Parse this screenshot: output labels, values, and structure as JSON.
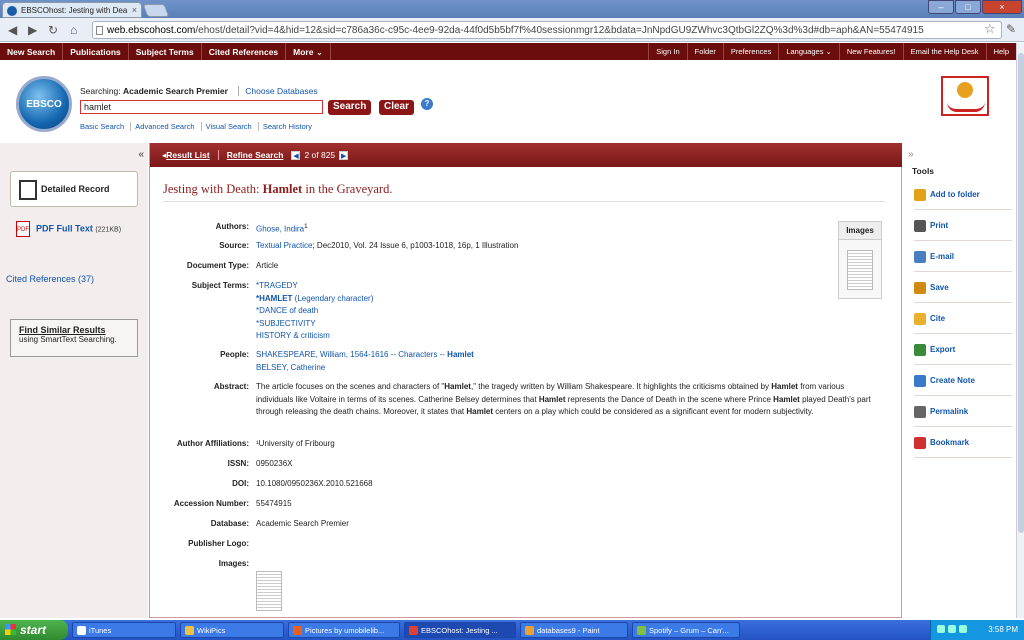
{
  "browser": {
    "tab_title": "EBSCOhost: Jesting with Dea",
    "url_host": "web.ebscohost.com",
    "url_path": "/ehost/detail?vid=4&hid=12&sid=c786a36c-c95c-4ee9-92da-44f0d5b5bf7f%40sessionmgr12&bdata=JnNpdGU9ZWhvc3QtbGl2ZQ%3d%3d#db=aph&AN=55474915"
  },
  "topnav": {
    "left": [
      "New Search",
      "Publications",
      "Subject Terms",
      "Cited References",
      "More ⌄"
    ],
    "right": [
      "Sign In",
      "Folder",
      "Preferences",
      "Languages ⌄",
      "New Features!",
      "Email the Help Desk",
      "Help"
    ]
  },
  "search": {
    "searching_label": "Searching:",
    "database": "Academic Search Premier",
    "choose": "Choose Databases",
    "query": "hamlet",
    "search_btn": "Search",
    "clear_btn": "Clear",
    "help": "?",
    "links": [
      "Basic Search",
      "Advanced Search",
      "Visual Search",
      "Search History"
    ]
  },
  "logo": {
    "text": "EBSCO"
  },
  "left": {
    "collapse": "«",
    "detailed": "Detailed Record",
    "pdf": "PDF Full Text",
    "pdf_size": "(221KB)",
    "cited": "Cited References (37)",
    "similar_title": "Find Similar Results",
    "similar_sub": "using SmartText Searching."
  },
  "toolbar": {
    "result_list": "Result List",
    "refine": "Refine Search",
    "position": "2 of 825"
  },
  "record": {
    "title_pre": "Jesting with Death: ",
    "title_b": "Hamlet",
    "title_post": " in the Graveyard.",
    "images_label": "Images",
    "labels": {
      "authors": "Authors:",
      "source": "Source:",
      "doctype": "Document Type:",
      "subject": "Subject Terms:",
      "people": "People:",
      "abstract": "Abstract:",
      "affil": "Author Affiliations:",
      "issn": "ISSN:",
      "doi": "DOI:",
      "accession": "Accession Number:",
      "database": "Database:",
      "publisher": "Publisher Logo:",
      "images": "Images:"
    },
    "author": "Ghose, Indira",
    "author_sup": "1",
    "source_link": "Textual Practice",
    "source_rest": "; Dec2010, Vol. 24 Issue 6, p1003-1018, 16p, 1 Illustration",
    "doctype": "Article",
    "subj1": "*TRAGEDY",
    "subj2_b": "*HAMLET",
    "subj2_rest": " (Legendary character)",
    "subj3": "*DANCE of death",
    "subj4": "*SUBJECTIVITY",
    "subj5": "HISTORY & criticism",
    "people1": "SHAKESPEARE, William, 1564-1616 -- Characters -- ",
    "people1_b": "Hamlet",
    "people2": "BELSEY, Catherine",
    "abs1": "The article focuses on the scenes and characters of \"",
    "abs_b1": "Hamlet",
    "abs2": ",\" the tragedy written by William Shakespeare. It highlights the criticisms obtained by ",
    "abs_b2": "Hamlet",
    "abs3": " from various individuals like Voltaire in terms of its scenes. Catherine Belsey determines that ",
    "abs_b3": "Hamlet",
    "abs4": " represents the Dance of Death in the scene where Prince ",
    "abs_b4": "Hamlet",
    "abs5": " played Death's part through releasing the death chains. Moreover, it states that ",
    "abs_b5": "Hamlet",
    "abs6": " centers on a play which could be considered as a significant event for modern subjectivity.",
    "affil": "¹University of Fribourg",
    "issn": "0950236X",
    "doi": "10.1080/0950236X.2010.521668",
    "accession": "55474915",
    "database": "Academic Search Premier"
  },
  "tools": {
    "collapse": "»",
    "heading": "Tools",
    "items": [
      "Add to folder",
      "Print",
      "E-mail",
      "Save",
      "Cite",
      "Export",
      "Create Note",
      "Permalink",
      "Bookmark"
    ],
    "colors": [
      "#e3a21a",
      "#555555",
      "#4a7fc0",
      "#d08a10",
      "#e8b030",
      "#3a8a3a",
      "#3a78c8",
      "#666666",
      "#d03030"
    ]
  },
  "taskbar": {
    "start": "start",
    "items": [
      "iTunes",
      "WikiPics",
      "Pictures by umobilelib...",
      "EBSCOhost: Jesting ...",
      "databases9 - Paint",
      "Spotify – Grum – Can'..."
    ],
    "clock": "3:58 PM"
  }
}
